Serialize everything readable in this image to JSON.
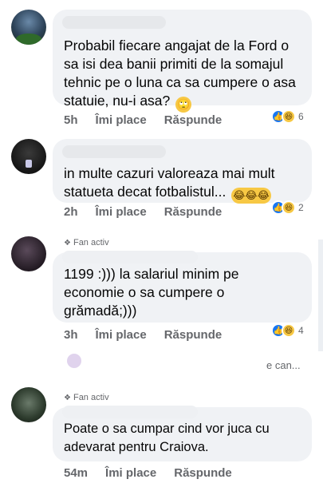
{
  "comments": [
    {
      "text": "Probabil fiecare angajat de la Ford o sa isi dea banii primiti de la somajul tehnic pe o luna ca sa cumpere o asa statuie, nu-i asa?",
      "emoji": "🙄",
      "time": "5h",
      "like_label": "Îmi place",
      "reply_label": "Răspunde",
      "reaction_count": "6"
    },
    {
      "text": "in multe cazuri valoreaza mai mult statueta decat fotbalistul...",
      "emoji": "😂😂😂",
      "time": "2h",
      "like_label": "Îmi place",
      "reply_label": "Răspunde",
      "reaction_count": "2"
    },
    {
      "badge": "Fan activ",
      "text": "1199 :))) la salariul minim pe economie o sa cumpere o grămadă;)))",
      "time": "3h",
      "like_label": "Îmi place",
      "reply_label": "Răspunde",
      "reaction_count": "4",
      "more_replies": "e can..."
    },
    {
      "badge": "Fan activ",
      "text": "Poate o sa cumpar cind vor juca cu adevarat pentru Craiova.",
      "time": "54m",
      "like_label": "Îmi place",
      "reply_label": "Răspunde"
    }
  ],
  "reaction_icons": [
    "like-icon",
    "haha-icon"
  ],
  "colors": {
    "bubble": "#f0f2f5",
    "meta": "#65676b",
    "like": "#1877f2",
    "haha": "#f7c844"
  }
}
